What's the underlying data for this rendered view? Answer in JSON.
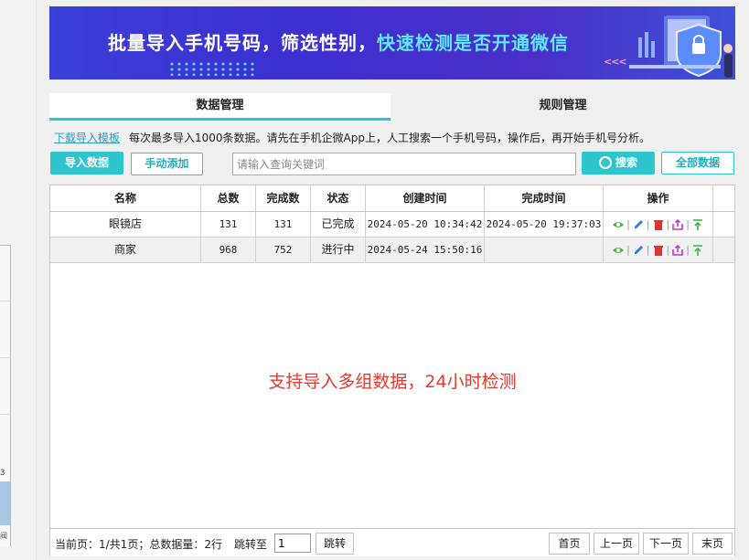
{
  "left_panel": {
    "row_count_label": "3",
    "footer_glyph": "阀"
  },
  "banner": {
    "title_part1": "批量导入手机号码，筛选性别，",
    "title_highlight": "快速检测是否开通微信",
    "chevrons": "<<<"
  },
  "tabs": [
    {
      "label": "数据管理",
      "active": true
    },
    {
      "label": "规则管理",
      "active": false
    }
  ],
  "notice": {
    "link": "下载导入模板",
    "text": "每次最多导入1000条数据。请先在手机企微App上，人工搜索一个手机号码，操作后，再开始手机号分析。"
  },
  "toolbar": {
    "import_label": "导入数据",
    "manual_label": "手动添加",
    "search_placeholder": "请输入查询关键词",
    "search_label": "搜索",
    "all_label": "全部数据"
  },
  "table": {
    "headers": [
      "名称",
      "总数",
      "完成数",
      "状态",
      "创建时间",
      "完成时间",
      "操作"
    ],
    "rows": [
      {
        "name": "眼镜店",
        "total": "131",
        "done": "131",
        "status": "已完成",
        "created": "2024-05-20 10:34:42",
        "finished": "2024-05-20 19:37:03"
      },
      {
        "name": "商家",
        "total": "968",
        "done": "752",
        "status": "进行中",
        "created": "2024-05-24 15:50:16",
        "finished": ""
      }
    ],
    "op_icons": [
      "eye-icon",
      "edit-icon",
      "trash-icon",
      "export-icon",
      "pin-top-icon"
    ],
    "op_separator": "|",
    "empty_message": "支持导入多组数据，24小时检测"
  },
  "pager": {
    "info": "当前页：1/共1页；总数据量：2行",
    "jump_label": "跳转至",
    "jump_value": "1",
    "go_label": "跳转",
    "first_label": "首页",
    "prev_label": "上一页",
    "next_label": "下一页",
    "last_label": "末页"
  },
  "colors": {
    "accent": "#2ec5cf",
    "banner_bg": "#3a3fd8",
    "highlight": "#5fe8ff",
    "alert": "#e8392f"
  }
}
